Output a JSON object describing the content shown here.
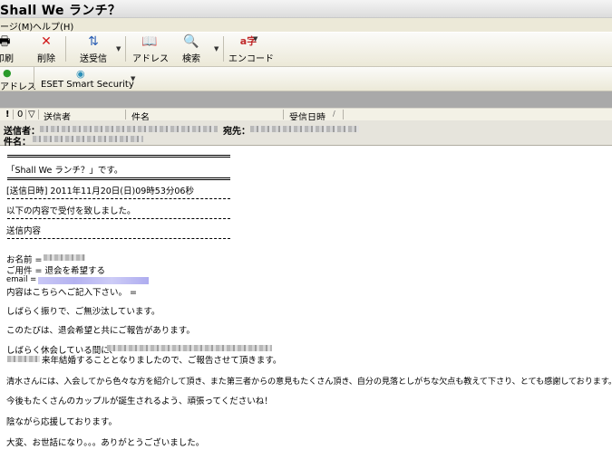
{
  "window": {
    "title": "Shall We ランチ？"
  },
  "menu": {
    "items": [
      "ージ(M)",
      "ヘルプ(H)"
    ]
  },
  "toolbar": {
    "buttons": [
      {
        "label": "印刷",
        "icon": "print-icon"
      },
      {
        "label": "削除",
        "icon": "delete-icon"
      },
      {
        "label": "送受信",
        "icon": "send-receive-icon"
      },
      {
        "label": "アドレス",
        "icon": "address-book-icon"
      },
      {
        "label": "検索",
        "icon": "search-icon"
      },
      {
        "label": "エンコード",
        "icon": "encode-icon"
      }
    ]
  },
  "toolbar2": {
    "address_label": "アドレス",
    "eset_label": "ESET Smart Security"
  },
  "columns": {
    "sender": "送信者",
    "subject": "件名",
    "date": "受信日時",
    "icons": [
      "!",
      "0",
      "▽"
    ]
  },
  "header": {
    "from_label": "送信者：",
    "to_label": "宛先：",
    "subject_label": "件名："
  },
  "message": {
    "rule": "================================================",
    "title_line": "「Shall We ランチ？」です。",
    "date_line": "[送信日時] 2011年11月20日(日)09時53分06秒",
    "dash_rule": "-----------------------------------------------------------------------",
    "accepted_line": "以下の内容で受付を致しました。",
    "content_label": "送信内容",
    "name_line": "お名前 =",
    "requirement_line": " ご用件 = 退会を希望する",
    "email_line": " email =",
    "body_prompt_line": " 内容はこちらへご記入下さい。 =",
    "p1": "しばらく振りで、ご無沙汰しています。",
    "p2": "このたびは、退会希望と共にご報告があります。",
    "p3a": "しばらく休会している間に、",
    "p3b": "来年結婚することとなりましたので、ご報告させて頂きます。",
    "p4": "清水さんには、入会してから色々な方を紹介して頂き、また第三者からの意見もたくさん頂き、自分の見落としがちな欠点も教えて下さり、とても感謝しております。",
    "p5": "今後もたくさんのカップルが誕生されるよう、頑張ってくださいね！",
    "p6": "陰ながら応援しております。",
    "p7": "大変、お世話になり。。。ありがとうございました。"
  }
}
